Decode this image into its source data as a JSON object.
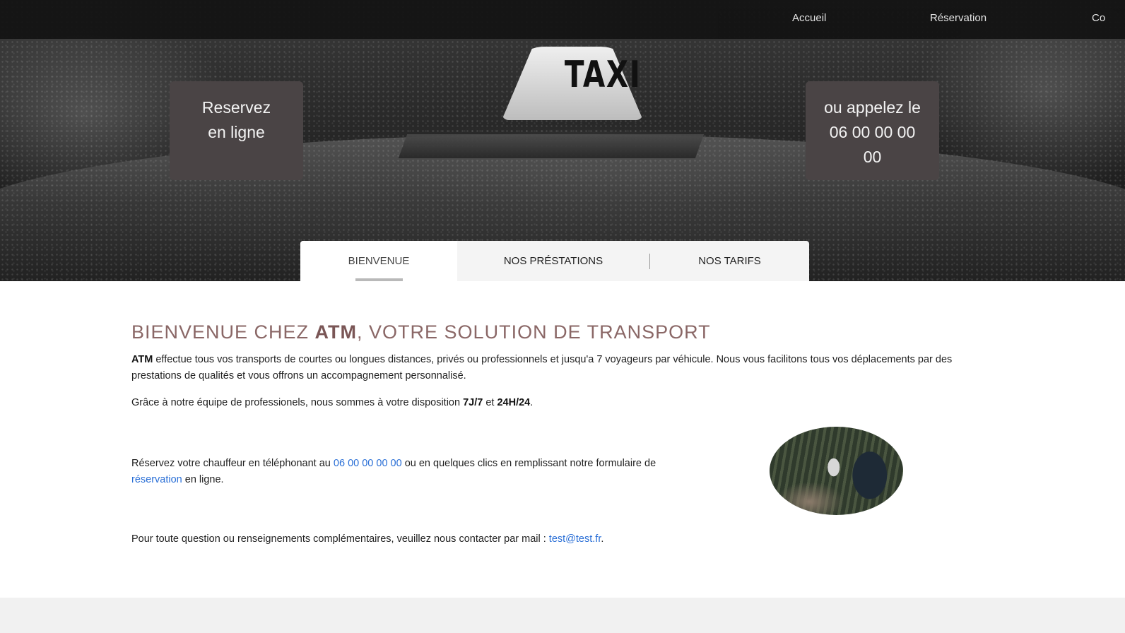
{
  "nav": {
    "items": [
      "Accueil",
      "Réservation",
      "Co"
    ]
  },
  "hero": {
    "sign_text": "TAXI",
    "cta_left": {
      "line1": "Reservez",
      "line2": "en ligne"
    },
    "cta_right": {
      "line1": "ou appelez le",
      "line2": "06 00 00 00",
      "line3": "00"
    }
  },
  "tabs": [
    {
      "label": "BIENVENUE",
      "active": true
    },
    {
      "label": "NOS PRÉSTATIONS",
      "active": false
    },
    {
      "label": "NOS TARIFS",
      "active": false
    }
  ],
  "content": {
    "headline_pre": "BIENVENUE CHEZ ",
    "headline_brand": "ATM",
    "headline_post": ", VOTRE SOLUTION DE TRANSPORT",
    "p1_brand": "ATM",
    "p1_text_a": " effectue tous vos transports de courtes ou longues distances, privés ou professionnels et jusqu'a 7 voyageurs par véhicule. Nous vous facilitons tous vos déplacements par des",
    "p1_text_b": "prestations de qualités et vous offrons un accompagnement personnalisé.",
    "p2_text_a": "Grâce à notre équipe de professionels, nous sommes à votre disposition ",
    "p2_bold_1": "7J/7",
    "p2_text_b": " et ",
    "p2_bold_2": "24H/24",
    "p2_text_c": ".",
    "p3_text_a": "Réservez votre chauffeur en téléphonant au ",
    "p3_phone": "06 00 00 00 00",
    "p3_text_b": " ou en quelques clics en remplissant notre formulaire de",
    "p3_link": "réservation",
    "p3_text_c": " en ligne.",
    "p4_text_a": "Pour toute question ou renseignements complémentaires, veuillez nous contacter par mail : ",
    "p4_email": "test@test.fr",
    "p4_text_b": "."
  },
  "colors": {
    "headline": "#8a6766",
    "link": "#2a6fd6",
    "cta_box": "#4a4445"
  }
}
